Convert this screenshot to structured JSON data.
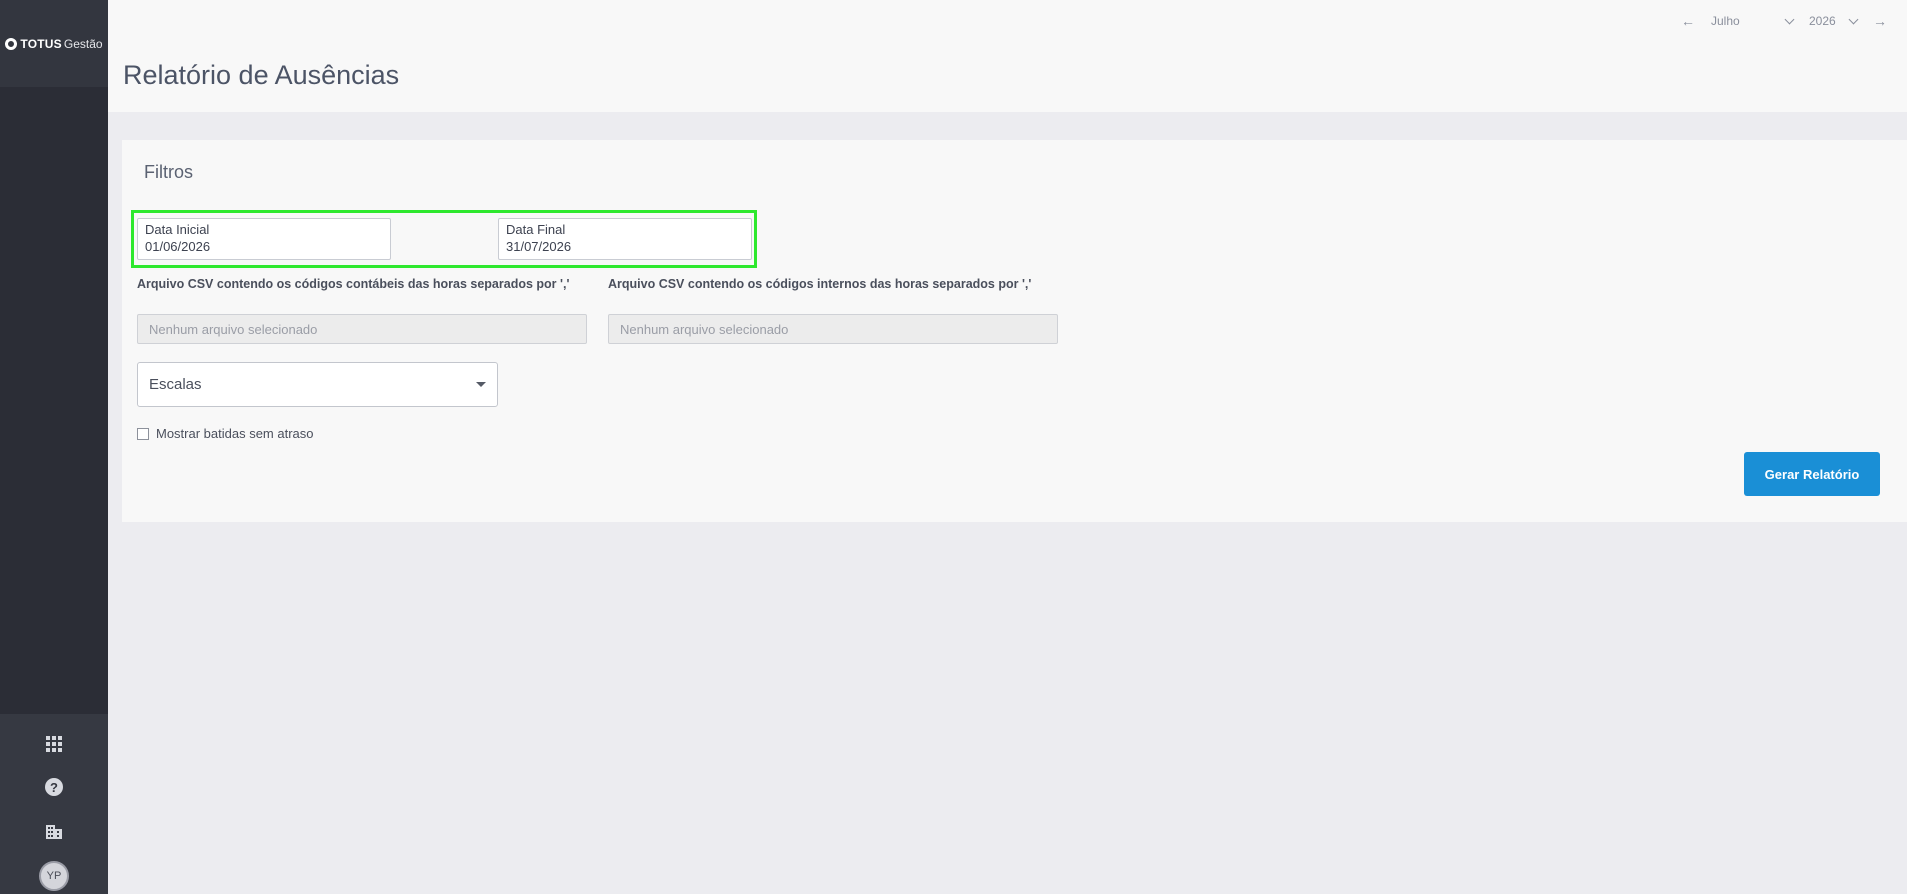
{
  "app": {
    "logo_main": "TOTUS",
    "logo_sub": "Gestão"
  },
  "header": {
    "title": "Relatório de Ausências",
    "month": "Julho",
    "year": "2026"
  },
  "sidebar": {
    "avatar_initials": "YP",
    "icons": [
      "apps-grid-icon",
      "help-icon",
      "building-icon"
    ]
  },
  "filters": {
    "title": "Filtros",
    "date_start": {
      "label": "Data Inicial",
      "value": "01/06/2026"
    },
    "date_end": {
      "label": "Data Final",
      "value": "31/07/2026"
    },
    "csv_accounting": {
      "label": "Arquivo CSV contendo os códigos contábeis das horas separados por ','",
      "placeholder": "Nenhum arquivo selecionado"
    },
    "csv_internal": {
      "label": "Arquivo CSV contendo os códigos internos das horas separados por ','",
      "placeholder": "Nenhum arquivo selecionado"
    },
    "escalas": {
      "label": "Escalas"
    },
    "show_punches": {
      "label": "Mostrar batidas sem atraso",
      "checked": false
    },
    "submit_label": "Gerar Relatório"
  },
  "colors": {
    "highlight": "#2ee82e",
    "primary_button": "#1a8fd6",
    "sidebar": "#2b2d36"
  }
}
